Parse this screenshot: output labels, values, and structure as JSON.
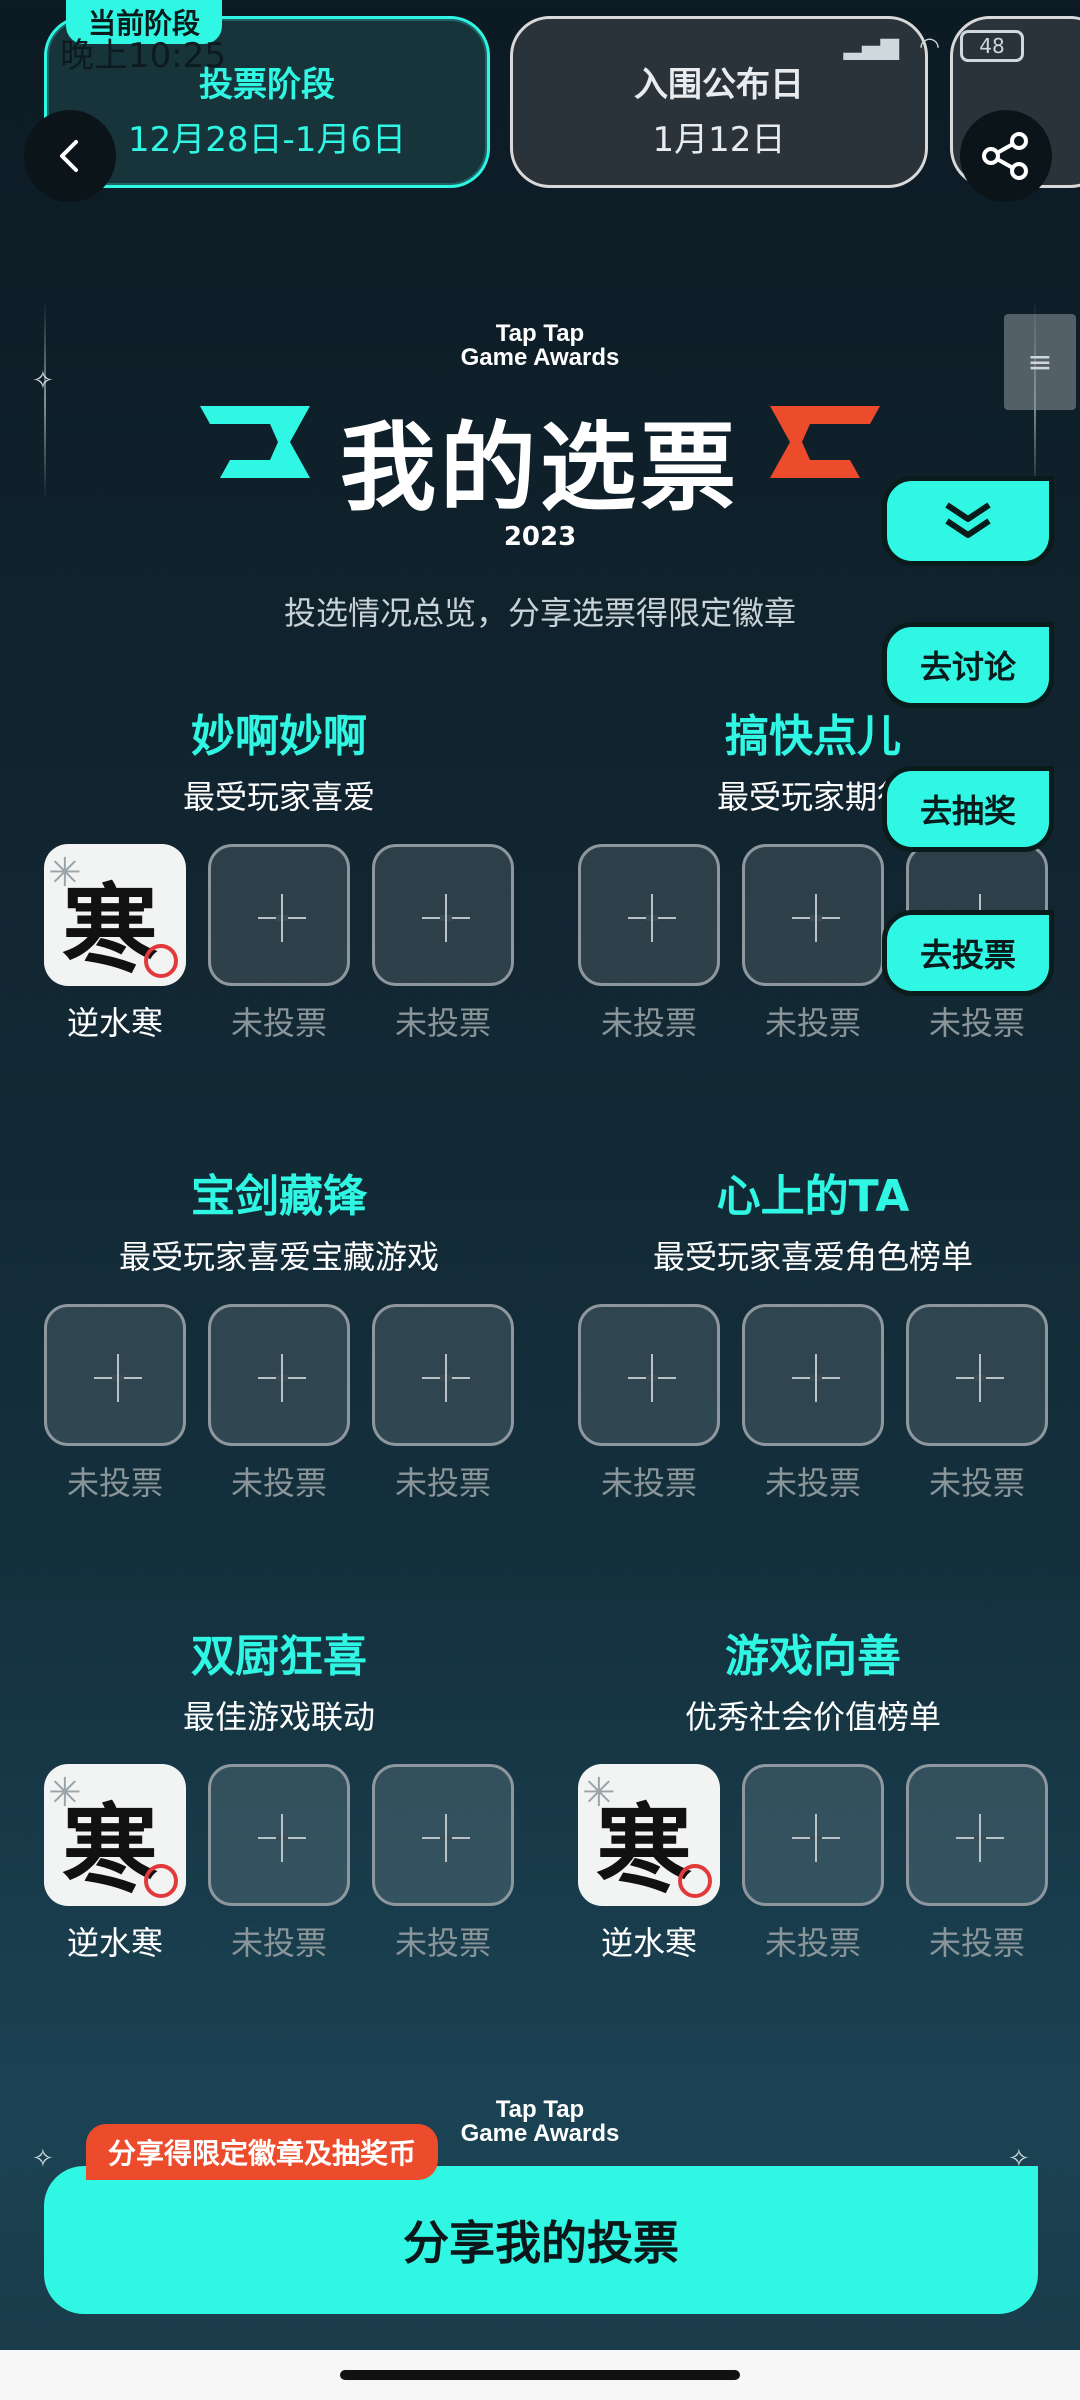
{
  "status_bar": {
    "time": "晚上10:25",
    "battery": "48"
  },
  "phases": {
    "current_badge": "当前阶段",
    "active": {
      "title": "投票阶段",
      "date": "12月28日-1月6日"
    },
    "next": {
      "title": "入围公布日",
      "date": "1月12日"
    }
  },
  "header": {
    "brand_line1": "Tap Tap",
    "brand_line2": "Game Awards",
    "title": "我的选票",
    "year": "2023",
    "subtitle": "投选情况总览，分享选票得限定徽章"
  },
  "float_buttons": {
    "discuss": "去讨论",
    "lottery": "去抽奖",
    "vote": "去投票"
  },
  "categories": [
    {
      "title": "妙啊妙啊",
      "subtitle": "最受玩家喜爱",
      "slots": [
        {
          "label": "逆水寒",
          "voted": true
        },
        {
          "label": "未投票"
        },
        {
          "label": "未投票"
        }
      ]
    },
    {
      "title": "搞快点儿",
      "subtitle": "最受玩家期待",
      "slots": [
        {
          "label": "未投票"
        },
        {
          "label": "未投票"
        },
        {
          "label": "未投票"
        }
      ]
    },
    {
      "title": "宝剑藏锋",
      "subtitle": "最受玩家喜爱宝藏游戏",
      "slots": [
        {
          "label": "未投票"
        },
        {
          "label": "未投票"
        },
        {
          "label": "未投票"
        }
      ]
    },
    {
      "title": "心上的TA",
      "subtitle": "最受玩家喜爱角色榜单",
      "slots": [
        {
          "label": "未投票"
        },
        {
          "label": "未投票"
        },
        {
          "label": "未投票"
        }
      ]
    },
    {
      "title": "双厨狂喜",
      "subtitle": "最佳游戏联动",
      "slots": [
        {
          "label": "逆水寒",
          "voted": true
        },
        {
          "label": "未投票"
        },
        {
          "label": "未投票"
        }
      ]
    },
    {
      "title": "游戏向善",
      "subtitle": "优秀社会价值榜单",
      "slots": [
        {
          "label": "逆水寒",
          "voted": true
        },
        {
          "label": "未投票"
        },
        {
          "label": "未投票"
        }
      ]
    }
  ],
  "game_icon_glyph": "寒",
  "bottom": {
    "tag": "分享得限定徽章及抽奖币",
    "brand_line1": "Tap Tap",
    "brand_line2": "Game Awards",
    "share_button": "分享我的投票"
  },
  "colors": {
    "accent": "#2ff7e3",
    "tag": "#ec4b2c",
    "bg": "#112530"
  },
  "icons": {
    "back": "back-arrow-icon",
    "share": "share-icon",
    "chevron": "double-chevron-down-icon"
  }
}
